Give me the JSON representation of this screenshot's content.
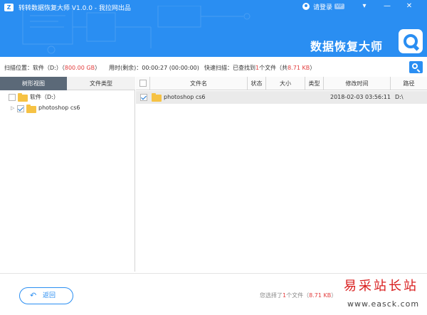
{
  "app": {
    "logo_letter": "Z",
    "title": "转转数据恢复大师 V1.0.0 - 我拉网出品",
    "login_label": "请登录",
    "vip_badge": "VIP",
    "brand": "数据恢复大师"
  },
  "window_controls": {
    "menu": "▾",
    "minimize": "—",
    "close": "✕"
  },
  "scan": {
    "location_label": "扫描位置：软件（D:）（",
    "location_size": "800.00 GB",
    "location_close": "）",
    "time_label": "用时(剩余)：00:00:27 (00:00:00)",
    "quick_label": "快速扫描：已查找到",
    "found_count": "1",
    "found_text": "个文件（共",
    "found_size": "8.71 KB",
    "found_close": "）"
  },
  "tabs": {
    "tree": "树形视图",
    "type": "文件类型"
  },
  "tree": [
    {
      "label": "软件（D:）",
      "checked": false,
      "icon": "folder-icon"
    },
    {
      "label": "photoshop cs6",
      "checked": true,
      "icon": "folder-icon"
    }
  ],
  "columns": [
    "文件名",
    "状态",
    "大小",
    "类型",
    "修改时间",
    "路径"
  ],
  "rows": [
    {
      "name": "photoshop cs6",
      "status": "",
      "size": "",
      "type": "",
      "modified": "2018-02-03 03:56:11",
      "path": "D:\\",
      "checked": true
    }
  ],
  "footer": {
    "back_label": "返回",
    "status_prefix": "您选择了",
    "status_count": "1",
    "status_mid": "个文件（",
    "status_size": "8.71 KB",
    "status_suffix": "）"
  },
  "watermark": {
    "cn": "易采站长站",
    "url": "www.easck.com"
  },
  "colors": {
    "primary": "#2a8ef2",
    "accent_red": "#e23c3c",
    "folder": "#f6c244",
    "tab_active": "#5b6978"
  }
}
